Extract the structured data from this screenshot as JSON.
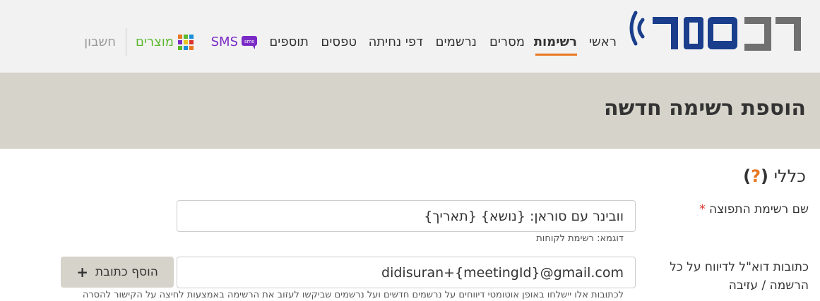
{
  "brand": {
    "logo_text": "רב מסר"
  },
  "nav": {
    "items": [
      {
        "label": "ראשי"
      },
      {
        "label": "רשימות"
      },
      {
        "label": "מסרים"
      },
      {
        "label": "נרשמים"
      },
      {
        "label": "דפי נחיתה"
      },
      {
        "label": "טפסים"
      },
      {
        "label": "תוספים"
      },
      {
        "label": "SMS"
      },
      {
        "label": "מוצרים"
      },
      {
        "label": "חשבון"
      }
    ],
    "active": "רשימות",
    "sms_icon_text": "sms"
  },
  "page": {
    "title": "הוספת רשימה חדשה"
  },
  "section": {
    "title": "כללי",
    "help_mark": "?"
  },
  "form": {
    "list_name": {
      "label": "שם רשימת התפוצה",
      "required_mark": "*",
      "value": "וובינר עם סוראן: {נושא} {תאריך}",
      "hint": "דוגמא: רשימת לקוחות"
    },
    "report_emails": {
      "label": "כתובות דוא\"ל לדיווח על כל הרשמה / עזיבה",
      "value": "didisuran+{meetingId}@gmail.com",
      "add_button_label": "הוסף כתובת",
      "hint": "לכתובות אלו יישלחו באופן אוטומטי דיווחים על נרשמים חדשים ועל נרשמים שביקשו לעזוב את הרשימה באמצעות לחיצה על הקישור להסרה"
    }
  },
  "colors": {
    "accent": "#e87722",
    "logo_blue": "#1a3e8c",
    "logo_gray": "#707070",
    "sms_purple": "#7a2bc6",
    "products_green": "#5cb82e",
    "banner": "#d5d3ca"
  },
  "icons": [
    "signal-waves-icon",
    "sms-bubble-icon",
    "grid-icon",
    "plus-icon"
  ]
}
